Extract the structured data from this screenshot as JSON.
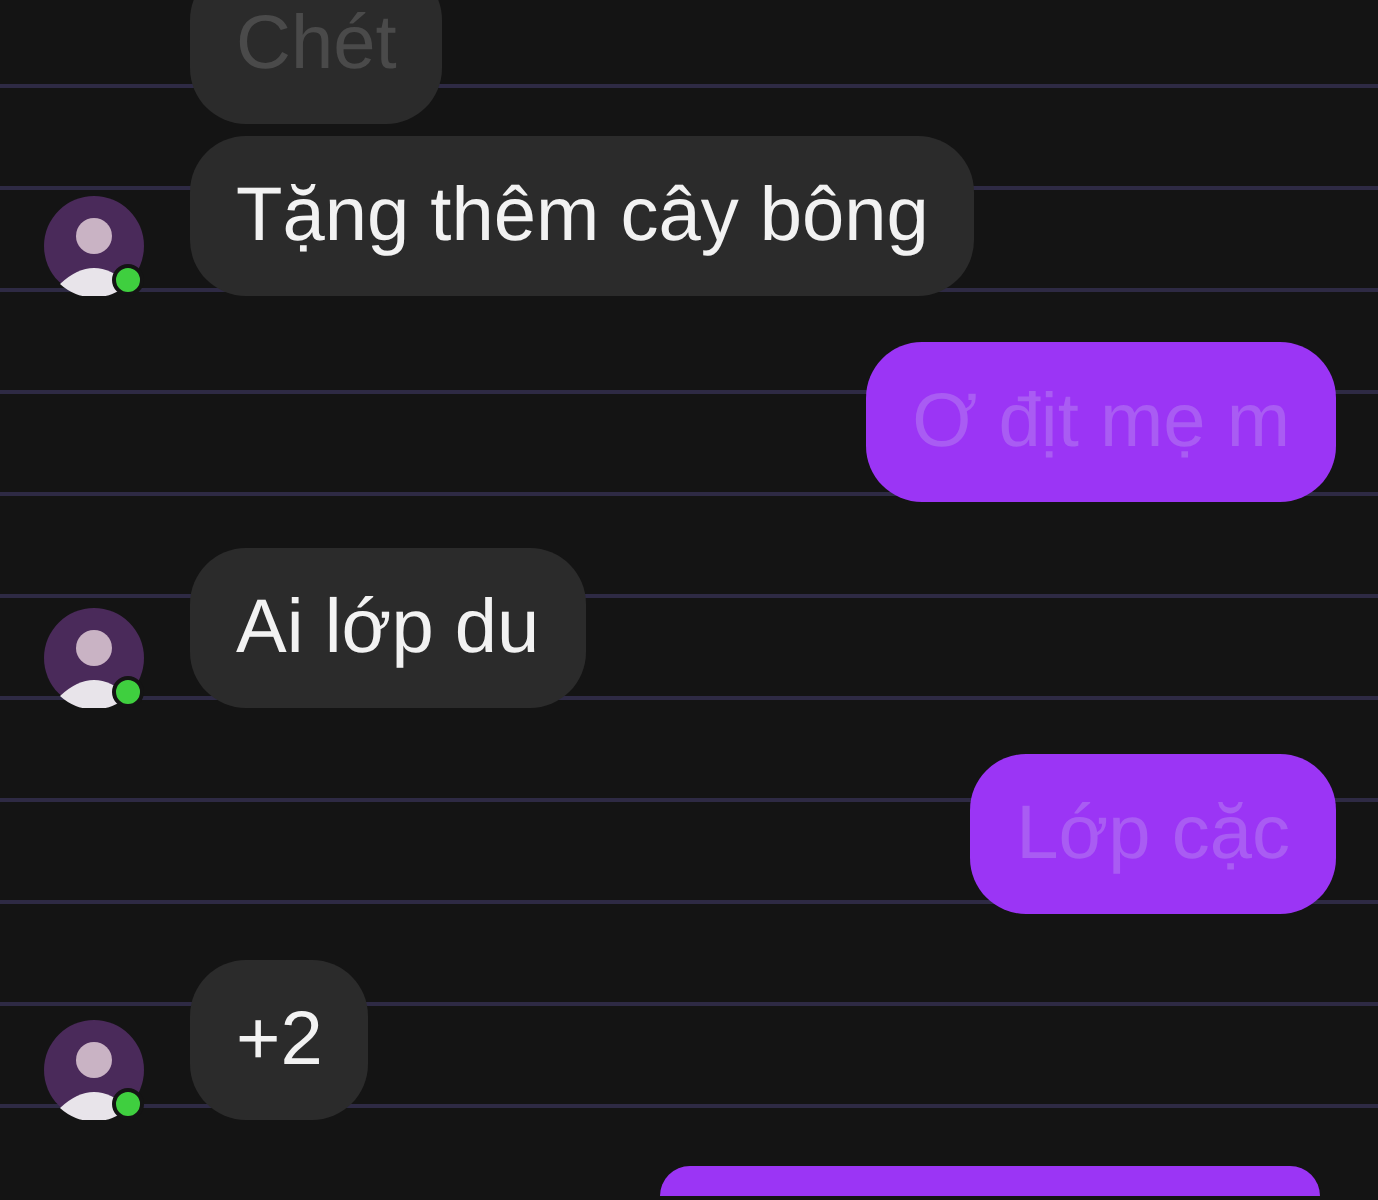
{
  "messages": [
    {
      "kind": "received",
      "text": "Chét",
      "faded": true
    },
    {
      "kind": "received",
      "text": "Tặng thêm cây bông",
      "faded": false,
      "avatar": true,
      "online": true
    },
    {
      "kind": "sent",
      "text": "Ơ địt mẹ m",
      "faded": true
    },
    {
      "kind": "received",
      "text": "Ai lớp du",
      "faded": false,
      "avatar": true,
      "online": true
    },
    {
      "kind": "sent",
      "text": "Lớp cặc",
      "faded": true
    },
    {
      "kind": "received",
      "text": "+2",
      "faded": false,
      "avatar": true,
      "online": true
    },
    {
      "kind": "sent"
    }
  ]
}
